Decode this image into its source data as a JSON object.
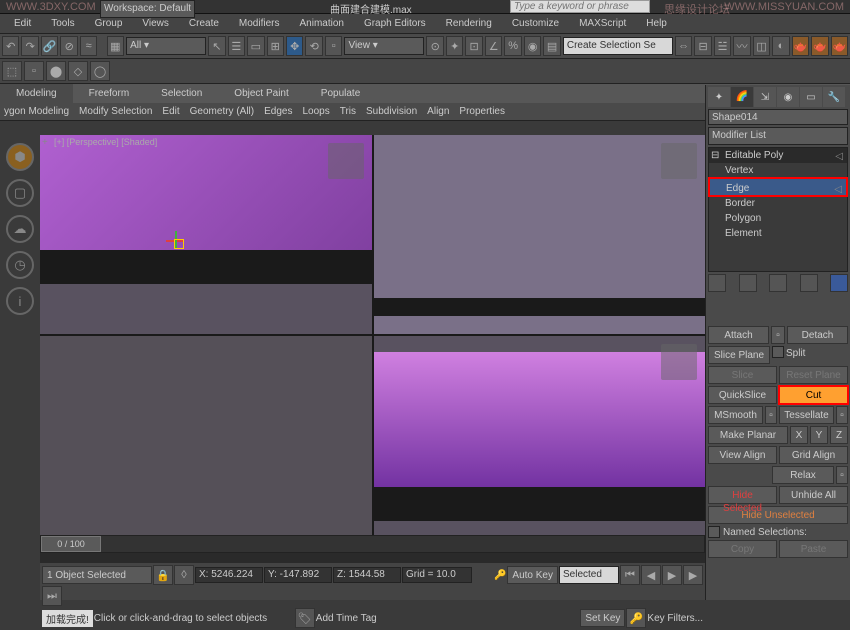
{
  "title_watermarks": {
    "left": "WWW.3DXY.COM",
    "center": "思缘设计论坛",
    "right": "WWW.MISSYUAN.COM"
  },
  "file_title": "曲面建合建模.max",
  "workspace_label": "Workspace: Default",
  "search_placeholder": "Type a keyword or phrase",
  "menu": [
    "Edit",
    "Tools",
    "Group",
    "Views",
    "Create",
    "Modifiers",
    "Animation",
    "Graph Editors",
    "Rendering",
    "Customize",
    "MAXScript",
    "Help"
  ],
  "create_sel": "Create Selection Se",
  "ribbon_tabs": [
    "Modeling",
    "Freeform",
    "Selection",
    "Object Paint",
    "Populate"
  ],
  "ribbon_row": [
    "ygon Modeling",
    "Modify Selection",
    "Edit",
    "Geometry (All)",
    "Edges",
    "Loops",
    "Tris",
    "Subdivision",
    "Align",
    "Properties"
  ],
  "vp_label": "[+] [Perspective] [Shaded]",
  "obj_name": "Shape014",
  "modlist": "Modifier List",
  "stack": {
    "head": "Editable Poly",
    "items": [
      "Vertex",
      "Edge",
      "Border",
      "Polygon",
      "Element"
    ]
  },
  "edit": {
    "attach": "Attach",
    "detach": "Detach",
    "sliceplane": "Slice Plane",
    "split": "Split",
    "slice": "Slice",
    "reset": "Reset Plane",
    "quickslice": "QuickSlice",
    "cut": "Cut",
    "msmooth": "MSmooth",
    "tessellate": "Tessellate",
    "makeplanar": "Make Planar",
    "x": "X",
    "y": "Y",
    "z": "Z",
    "viewalign": "View Align",
    "gridalign": "Grid Align",
    "relax": "Relax",
    "hidesel": "Hide Selected",
    "unhide": "Unhide All",
    "hideunsel": "Hide Unselected",
    "named": "Named Selections:",
    "copy": "Copy",
    "paste": "Paste"
  },
  "time": {
    "slider": "0 / 100"
  },
  "status": {
    "sel": "1 Object Selected",
    "x": "X: 5246.224",
    "y": "Y: -147.892",
    "z": "Z: 1544.58",
    "grid": "Grid = 10.0",
    "autokey": "Auto Key",
    "selected": "Selected",
    "setkey": "Set Key",
    "keyfilters": "Key Filters...",
    "hint": "Click or click-and-drag to select objects",
    "addtag": "Add Time Tag",
    "done": "加载完成!"
  }
}
